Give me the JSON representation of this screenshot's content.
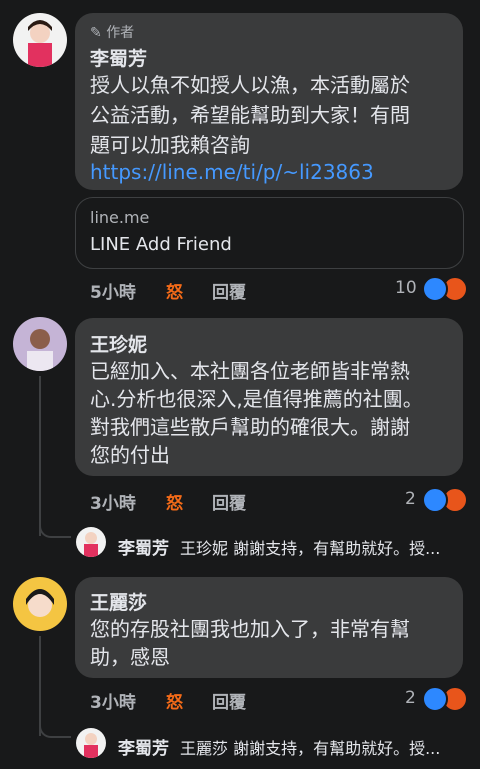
{
  "comments": [
    {
      "author_badge": "作者",
      "author": "李蜀芳",
      "lines": [
        "授人以魚不如授人以漁，本活動屬於",
        "公益活動，希望能幫助到大家！有問",
        "題可以加我賴咨詢"
      ],
      "link": "https://line.me/ti/p/~li23863",
      "preview": {
        "domain": "line.me",
        "title": "LINE Add Friend"
      },
      "time": "5小時",
      "reaction_word": "怒",
      "reply": "回覆",
      "reaction_count": "10"
    },
    {
      "author": "王珍妮",
      "lines": [
        "已經加入、本社團各位老師皆非常熱",
        "心.分析也很深入,是值得推薦的社團。",
        "對我們這些散戶幫助的確很大。謝謝",
        "您的付出"
      ],
      "time": "3小時",
      "reaction_word": "怒",
      "reply": "回覆",
      "reaction_count": "2",
      "reply_preview": {
        "author": "李蜀芳",
        "text": "王珍妮 謝謝支持，有幫助就好。授..."
      }
    },
    {
      "author": "王麗莎",
      "lines": [
        "您的存股社團我也加入了，非常有幫",
        "助，感恩"
      ],
      "time": "3小時",
      "reaction_word": "怒",
      "reply": "回覆",
      "reaction_count": "2",
      "reply_preview": {
        "author": "李蜀芳",
        "text": "王麗莎 謝謝支持，有幫助就好。授..."
      }
    }
  ],
  "colors": {
    "background": "#18191a",
    "bubble": "#3a3b3c",
    "link": "#4599ff",
    "like": "#2d88ff",
    "angry": "#e8551b"
  }
}
